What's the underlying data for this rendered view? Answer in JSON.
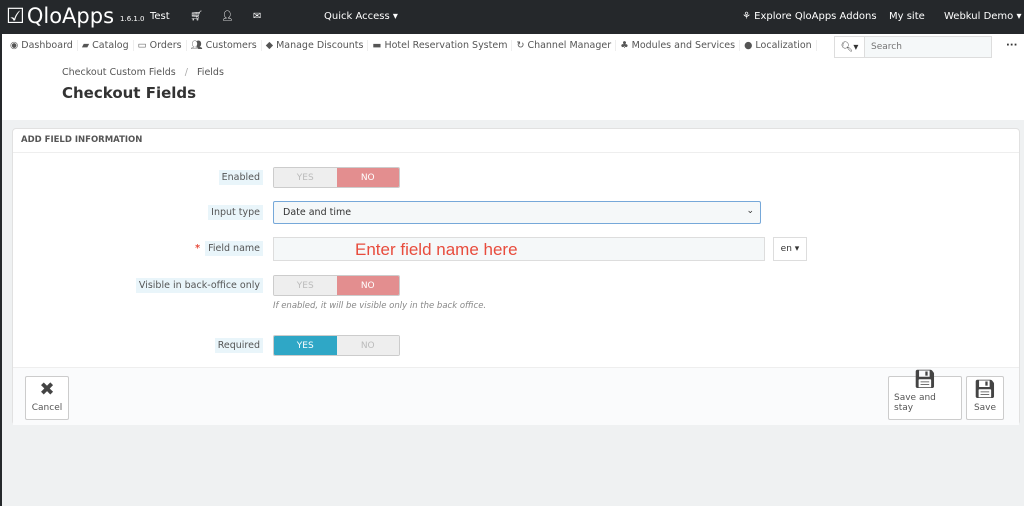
{
  "topbar": {
    "logo": "QloApps",
    "version": "1.6.1.0",
    "shop": "Test",
    "quick_access": "Quick Access",
    "addons": "Explore QloApps Addons",
    "my_site": "My site",
    "user": "Webkul Demo"
  },
  "menu": [
    {
      "label": "Dashboard",
      "icon": "dashboard-icon"
    },
    {
      "label": "Catalog",
      "icon": "book-icon"
    },
    {
      "label": "Orders",
      "icon": "credit-card-icon"
    },
    {
      "label": "Customers",
      "icon": "users-icon"
    },
    {
      "label": "Manage Discounts",
      "icon": "tags-icon"
    },
    {
      "label": "Hotel Reservation System",
      "icon": "bed-icon"
    },
    {
      "label": "Channel Manager",
      "icon": "refresh-icon"
    },
    {
      "label": "Modules and Services",
      "icon": "puzzle-icon"
    },
    {
      "label": "Localization",
      "icon": "globe-icon"
    }
  ],
  "search": {
    "placeholder": "Search"
  },
  "breadcrumb": {
    "parent": "Checkout Custom Fields",
    "sep": "/",
    "current": "Fields"
  },
  "page_title": "Checkout Fields",
  "panel": {
    "heading": "ADD FIELD INFORMATION",
    "enabled": {
      "label": "Enabled",
      "yes": "YES",
      "no": "NO",
      "value": "NO"
    },
    "input_type": {
      "label": "Input type",
      "value": "Date and time"
    },
    "field_name": {
      "label": "Field name",
      "value": "Enter field name here",
      "lang": "en"
    },
    "visible_bo": {
      "label": "Visible in back-office only",
      "yes": "YES",
      "no": "NO",
      "value": "NO",
      "help": "If enabled, it will be visible only in the back office."
    },
    "required": {
      "label": "Required",
      "yes": "YES",
      "no": "NO",
      "value": "YES"
    }
  },
  "footer": {
    "cancel": "Cancel",
    "save_stay": "Save and stay",
    "save": "Save"
  }
}
